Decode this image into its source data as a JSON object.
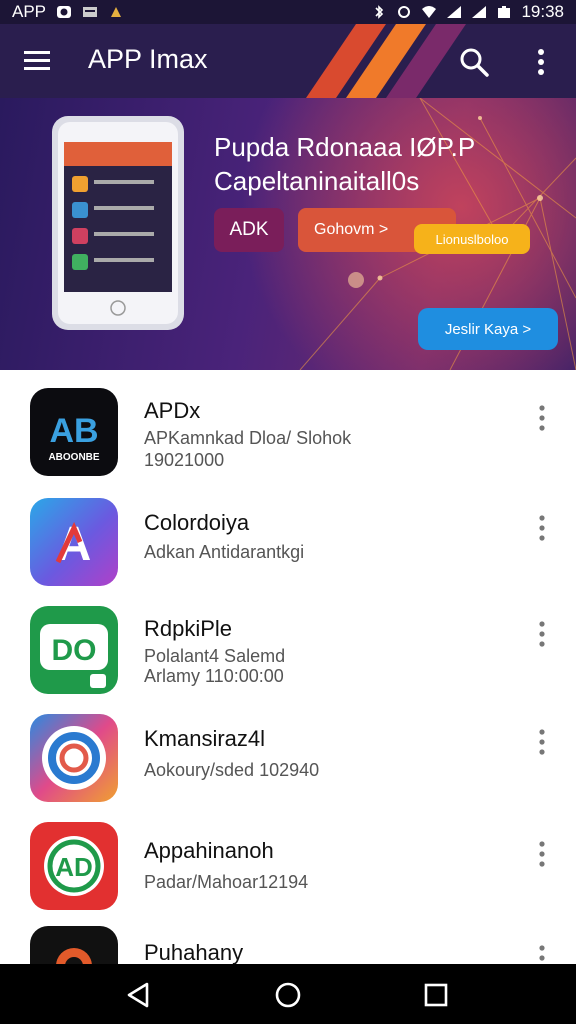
{
  "status_bar": {
    "app_label": "APP",
    "time": "19:38"
  },
  "toolbar": {
    "title": "APP Imax"
  },
  "banner": {
    "headline_line1": "Pupda Rdonaaa IØP.P",
    "headline_line2": "Capeltaninaitall0s",
    "apk_button": "ADK",
    "gohome_button": "Gohovm >",
    "yellow_button": "Lionuslboloo",
    "blue_button": "Jeslir Kaya >"
  },
  "apps": [
    {
      "name": "APDx",
      "line1": "APKamnkad Dloa/ Slohok",
      "line2": "19021000",
      "icon_text": "AB",
      "icon_subtext": "ABOONBE"
    },
    {
      "name": "Colordoiya",
      "line1": "Adkan Antidarantkgi",
      "line2": "",
      "icon_text": "A"
    },
    {
      "name": "RdpkiPle",
      "line1": "Polalant4 Salemd",
      "line2": "Arlamy 110:00:00",
      "icon_text": "DO"
    },
    {
      "name": "Kmansiraz4l",
      "line1": "Aokoury/sded 102940",
      "line2": "",
      "icon_text": ""
    },
    {
      "name": "Appahinanoh",
      "line1": "Padar/Mahoar12194",
      "line2": "",
      "icon_text": "AD"
    },
    {
      "name": "Puhahany",
      "line1": "",
      "line2": "",
      "icon_text": ""
    }
  ]
}
